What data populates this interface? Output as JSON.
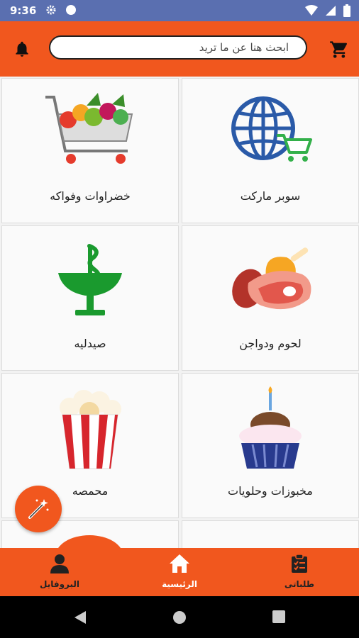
{
  "status_bar": {
    "time": "9:36"
  },
  "header": {
    "search_placeholder": "ابحث هنا عن ما تريد"
  },
  "categories": [
    {
      "label": "سوبر ماركت",
      "icon": "globe-cart-icon"
    },
    {
      "label": "خضراوات وفواكه",
      "icon": "vegetable-cart-icon"
    },
    {
      "label": "لحوم ودواجن",
      "icon": "meat-icon"
    },
    {
      "label": "صيدليه",
      "icon": "pharmacy-icon"
    },
    {
      "label": "مخبوزات وحلويات",
      "icon": "cupcake-icon"
    },
    {
      "label": "محمصه",
      "icon": "popcorn-icon"
    }
  ],
  "bottom_nav": {
    "orders_label": "طلباتى",
    "home_label": "الرئيسية",
    "profile_label": "البروفايل"
  },
  "colors": {
    "accent": "#f1571e",
    "status_bar": "#5a6fb0"
  }
}
